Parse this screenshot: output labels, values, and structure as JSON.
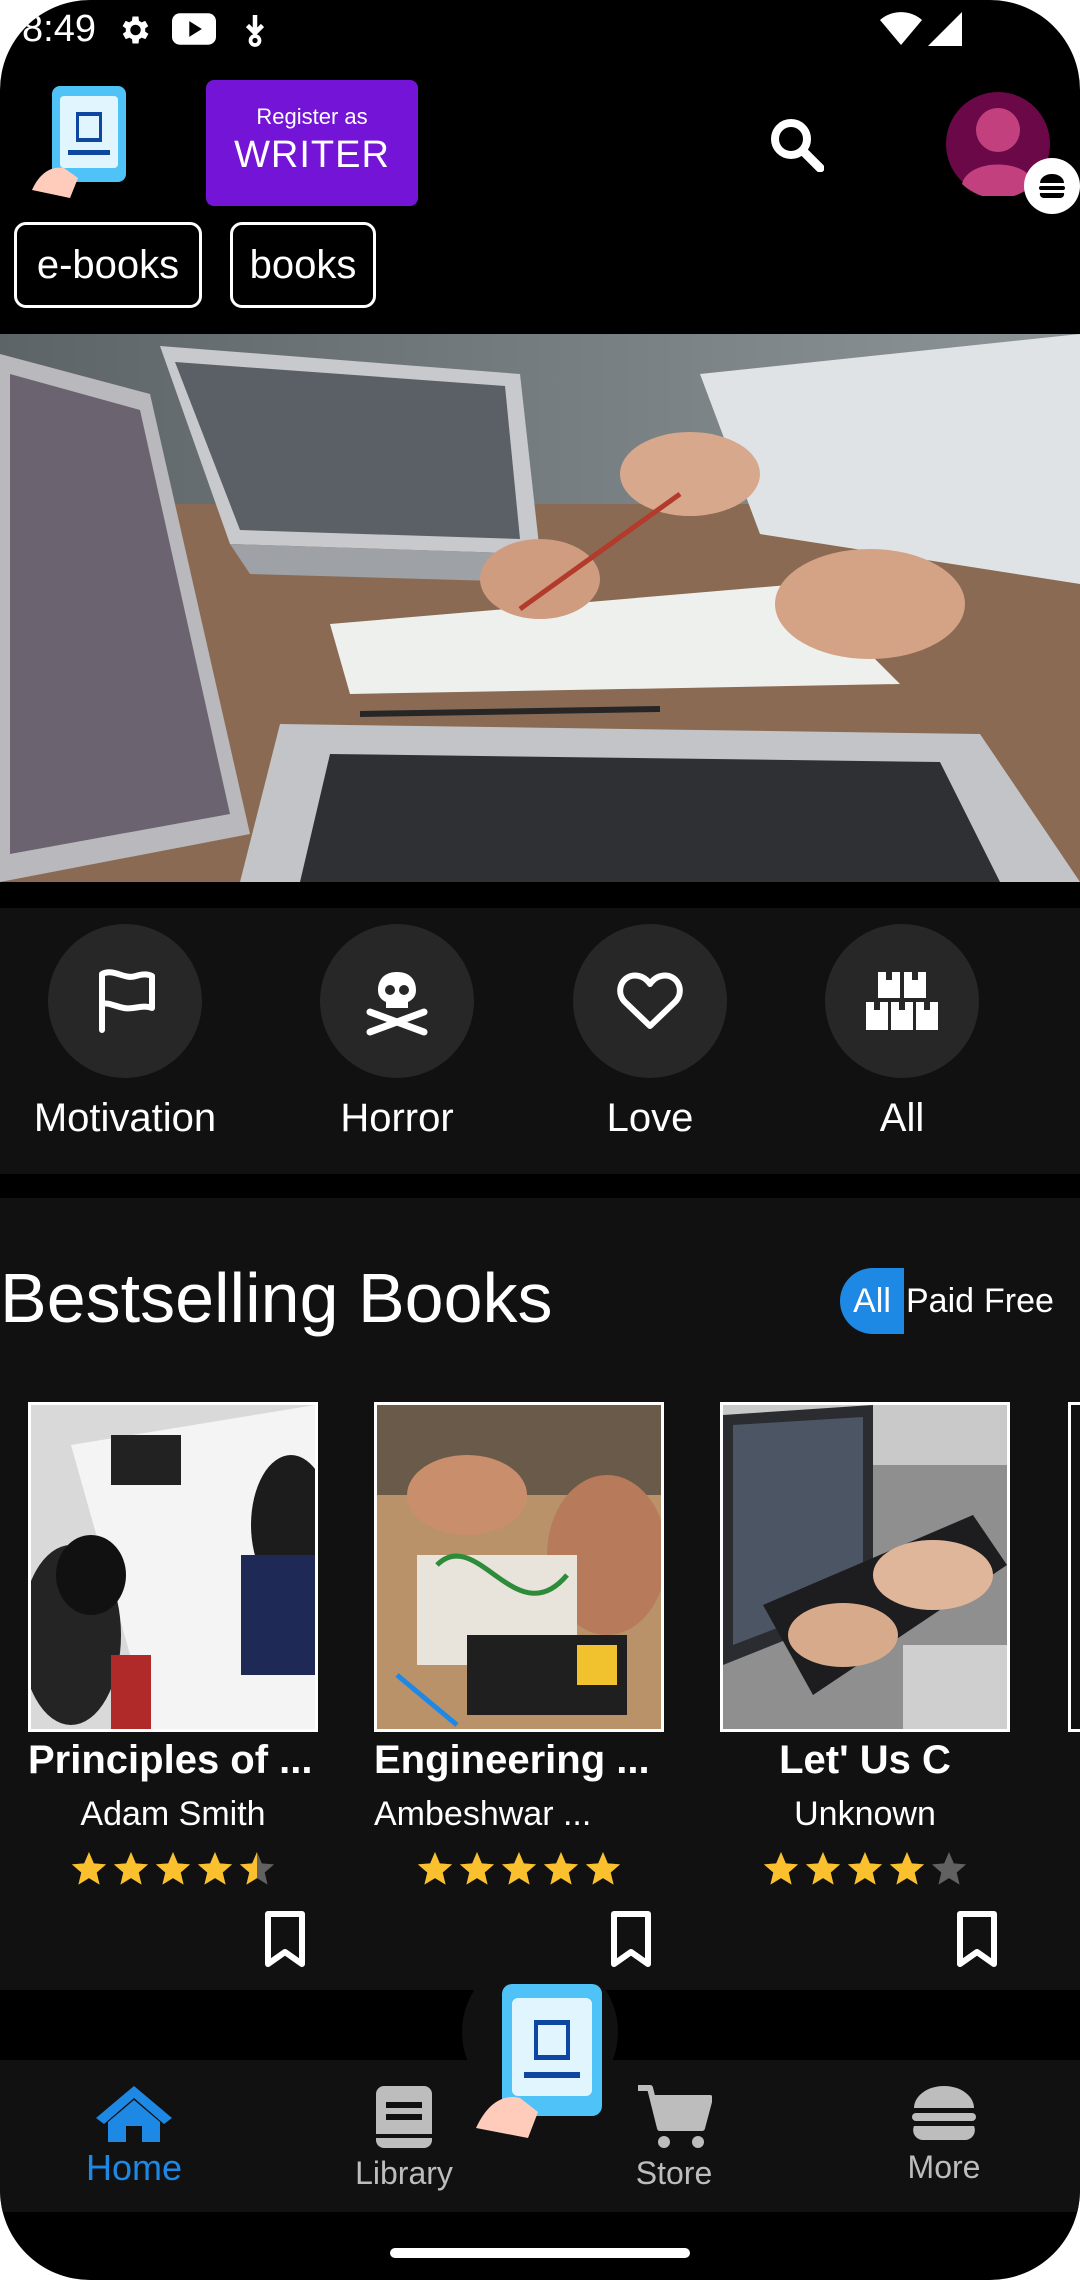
{
  "status_bar": {
    "time": "8:49",
    "icons": [
      "gear-icon",
      "youtube-icon",
      "download-icon",
      "wifi-icon",
      "signal-icon"
    ]
  },
  "header": {
    "logo_icon": "reading-phone-logo",
    "register_small": "Register as",
    "register_big": "WRITER",
    "search_icon": "search-icon",
    "avatar_icon": "avatar-icon",
    "menu_badge_icon": "burger-menu-icon"
  },
  "chips": [
    "e-books",
    "books"
  ],
  "banner": {
    "image": "laptops-on-desk-photo"
  },
  "categories": [
    {
      "label": "Motivation",
      "icon": "flag-icon"
    },
    {
      "label": "Horror",
      "icon": "skull-crossbones-icon"
    },
    {
      "label": "Love",
      "icon": "heart-icon"
    },
    {
      "label": "All",
      "icon": "boxes-icon"
    }
  ],
  "bestselling": {
    "title": "Bestselling Books",
    "filters": {
      "all": "All",
      "paid": "Paid",
      "free": "Free",
      "selected": "All"
    },
    "books": [
      {
        "title": "Principles of ...",
        "author": "Adam Smith",
        "rating": 4.5
      },
      {
        "title": "Engineering ...",
        "author": "Ambeshwar ...",
        "rating": 5
      },
      {
        "title": "Let' Us C",
        "author": "Unknown",
        "rating": 4
      }
    ]
  },
  "bottom_nav": [
    {
      "label": "Home",
      "icon": "home-icon",
      "active": true
    },
    {
      "label": "Library",
      "icon": "book-icon",
      "active": false
    },
    {
      "label": "Store",
      "icon": "cart-icon",
      "active": false
    },
    {
      "label": "More",
      "icon": "burger-icon",
      "active": false
    }
  ],
  "colors": {
    "accent": "#1e88e5",
    "register_button": "#7414d6",
    "star": "#fbc02d",
    "star_empty": "#616161",
    "section_bg": "#111111",
    "avatar_ring": "#6a0848",
    "avatar_fill": "#c2407e"
  }
}
